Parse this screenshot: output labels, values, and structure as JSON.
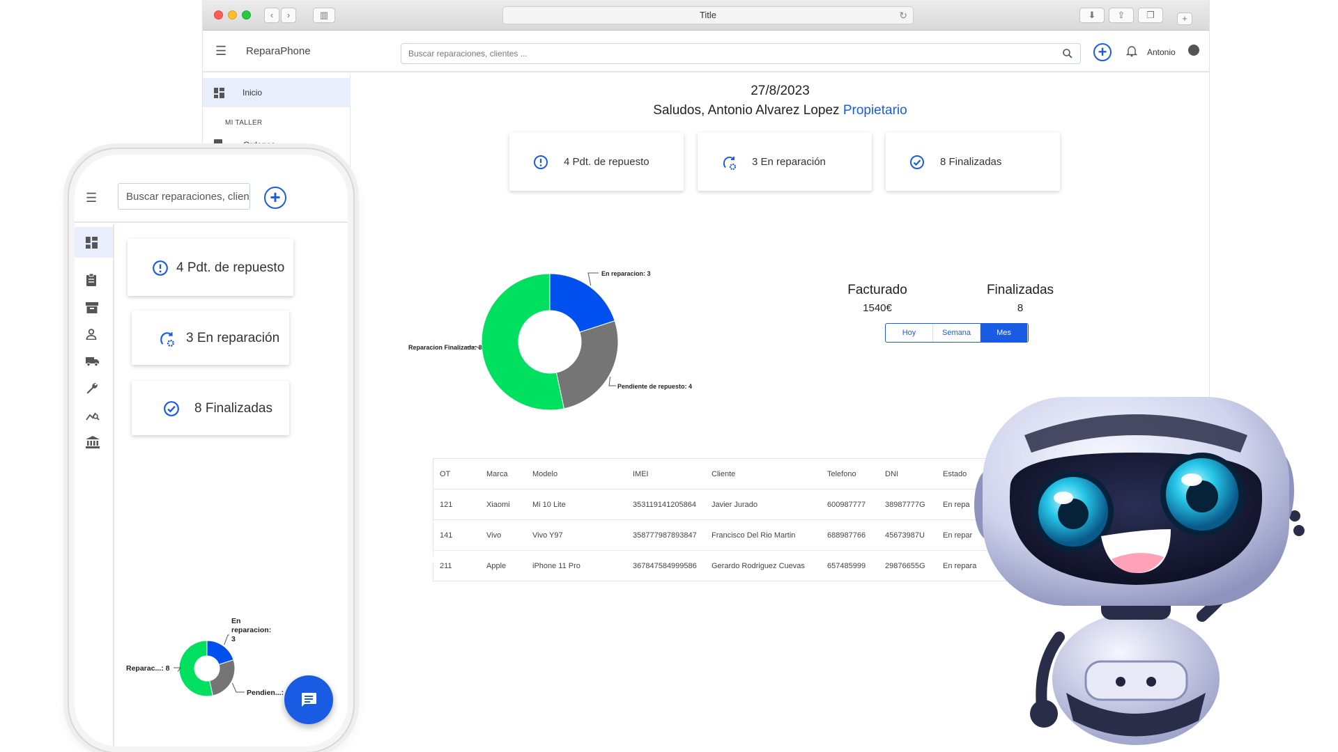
{
  "window": {
    "title": "Title"
  },
  "app": {
    "brand": "ReparaPhone",
    "search_placeholder": "Buscar reparaciones, clientes ...",
    "user": "Antonio"
  },
  "sidebar": {
    "inicio": "Inicio",
    "section": "MI TALLER",
    "ordenes": "Ordenes"
  },
  "dashboard": {
    "date": "27/8/2023",
    "greeting": "Saludos, Antonio Alvarez Lopez",
    "role": "Propietario",
    "kpis": [
      "4 Pdt. de repuesto",
      "3 En reparación",
      "8 Finalizadas"
    ],
    "facturado_label": "Facturado",
    "facturado_value": "1540€",
    "finalizadas_label": "Finalizadas",
    "finalizadas_value": "8",
    "periods": [
      "Hoy",
      "Semana",
      "Mes"
    ],
    "active_period": "Mes"
  },
  "chart_data": [
    {
      "type": "pie",
      "variant": "donut",
      "categories": [
        "En reparacion",
        "Pendiente de repuesto",
        "Reparacion Finalizada"
      ],
      "values": [
        3,
        4,
        8
      ],
      "labels": [
        "En reparacion: 3",
        "Pendiente de repuesto: 4",
        "Reparacion Finalizada: 8"
      ],
      "colors": [
        "#0050f0",
        "#757575",
        "#00e060"
      ]
    },
    {
      "type": "pie",
      "variant": "donut",
      "categories": [
        "En reparacion",
        "Pendiente de repuesto",
        "Reparacion Finalizada"
      ],
      "values": [
        3,
        4,
        8
      ],
      "labels": [
        "En reparacion: 3",
        "Pendien...:",
        "Reparac...: 8"
      ],
      "colors": [
        "#0050f0",
        "#757575",
        "#00e060"
      ]
    }
  ],
  "table": {
    "columns": [
      "OT",
      "Marca",
      "Modelo",
      "IMEI",
      "Cliente",
      "Telefono",
      "DNI",
      "Estado"
    ],
    "rows": [
      [
        "121",
        "Xiaomi",
        "Mi 10 Lite",
        "353119141205864",
        "Javier Jurado",
        "600987777",
        "38987777G",
        "En repa"
      ],
      [
        "141",
        "Vivo",
        "Vivo Y97",
        "358777987893847",
        "Francisco Del Rio Martin",
        "688987766",
        "45673987U",
        "En repar"
      ],
      [
        "211",
        "Apple",
        "iPhone 11 Pro",
        "367847584999586",
        "Gerardo Rodriguez Cuevas",
        "657485999",
        "29876655G",
        "En repara"
      ]
    ]
  },
  "mobile": {
    "search_placeholder": "Buscar reparaciones, clientes ...",
    "kpis": [
      "4 Pdt. de repuesto",
      "3 En reparación",
      "8 Finalizadas"
    ]
  },
  "colors": {
    "accent": "#1a5be4",
    "green": "#00e060",
    "grey": "#757575"
  }
}
